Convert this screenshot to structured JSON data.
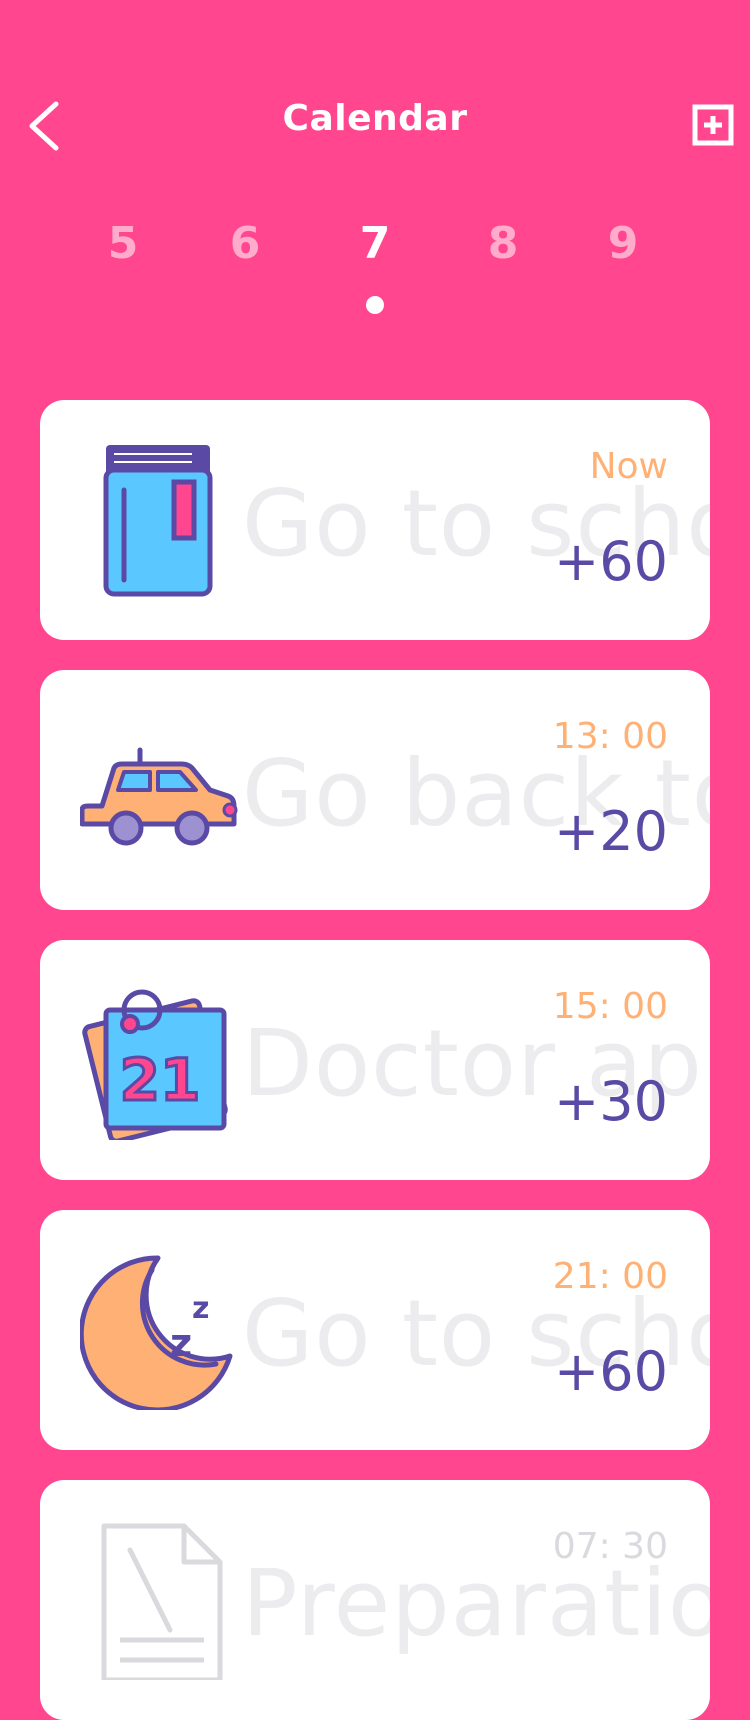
{
  "header": {
    "title": "Calendar"
  },
  "days": [
    {
      "label": "5",
      "active": false
    },
    {
      "label": "6",
      "active": false
    },
    {
      "label": "7",
      "active": true
    },
    {
      "label": "8",
      "active": false
    },
    {
      "label": "9",
      "active": false
    }
  ],
  "events": [
    {
      "title": "Go to scho",
      "time": "Now",
      "points": "+60",
      "icon": "book-icon"
    },
    {
      "title": "Go back to",
      "time": "13: 00",
      "points": "+20",
      "icon": "car-icon"
    },
    {
      "title": "Doctor app",
      "time": "15: 00",
      "points": "+30",
      "icon": "calendar-icon"
    },
    {
      "title": "Go to scho",
      "time": "21: 00",
      "points": "+60",
      "icon": "moon-sleep-icon"
    },
    {
      "title": "Preparatio",
      "time": "07: 30",
      "points": "",
      "icon": "document-pen-icon"
    }
  ],
  "colors": {
    "background": "#FF468F",
    "accent_time": "#FFB074",
    "points": "#5A4AA6"
  }
}
